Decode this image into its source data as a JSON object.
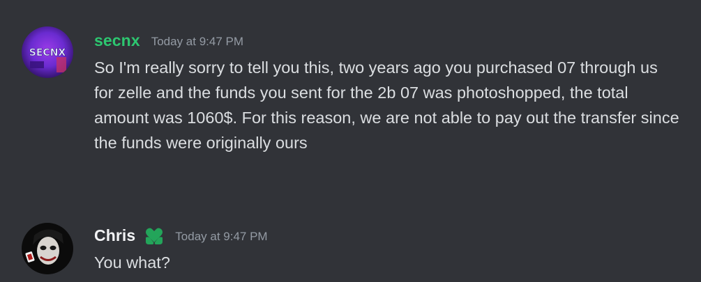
{
  "messages": [
    {
      "username": "secnx",
      "username_color": "#2dc770",
      "timestamp": "Today at 9:47 PM",
      "text": "So I'm really sorry to tell you this, two years ago you purchased 07 through us for zelle and the funds you sent for the 2b 07 was photoshopped, the total amount was 1060$. For this reason, we are not able to pay out the transfer since the funds were originally ours",
      "avatar": {
        "icon": "secnx-logo-avatar",
        "text": "SECNX",
        "colors": [
          "#2a0f5c",
          "#6a2bd0",
          "#9b3ce8"
        ]
      }
    },
    {
      "username": "Chris",
      "username_color": "#f2f3f5",
      "badge_icon": "heart-hands-icon",
      "badge_color": "#23a55a",
      "timestamp": "Today at 9:47 PM",
      "text": "You what?",
      "avatar": {
        "icon": "joker-avatar"
      }
    }
  ],
  "theme": {
    "background": "#313338",
    "text": "#dbdee1",
    "muted": "#949ba4"
  }
}
